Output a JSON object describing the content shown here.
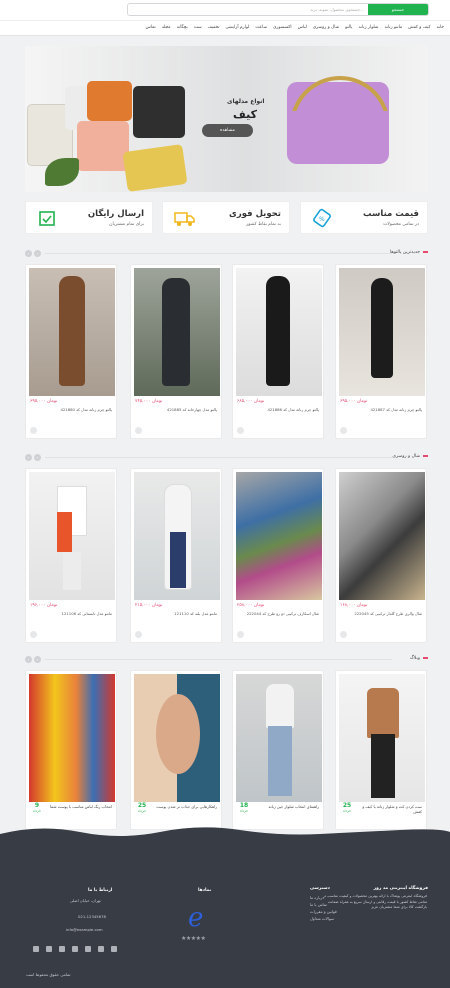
{
  "header": {
    "search_button": "جستجو",
    "search_placeholder": "جستجوی محصول، نمونه، برند..."
  },
  "nav": {
    "items": [
      "خانه",
      "کیف و کفش",
      "مانتو زنانه",
      "شلوار زنانه",
      "پالتو",
      "شال و روسری",
      "لباس",
      "اکسسوری",
      "ساعت",
      "لوازم آرایشی",
      "تخفیف",
      "ست",
      "بچگانه",
      "مجله",
      "تماس"
    ]
  },
  "banner": {
    "line1": "انواع مدلهای",
    "line2": "کیف",
    "button": "مشاهده"
  },
  "features": [
    {
      "title": "قیمت مناسب",
      "subtitle": "در تمامی محصولات"
    },
    {
      "title": "تحویل فوری",
      "subtitle": "به تمام نقاط کشور"
    },
    {
      "title": "ارسال رایگان",
      "subtitle": "برای تمام مشتریان"
    }
  ],
  "sections": {
    "s1": "جدیدترین پالتوها",
    "s2": "شال و روسری",
    "s3": "وبلاگ"
  },
  "products1": [
    {
      "price": "۶۹۵,۰۰۰ تومان",
      "name": "پالتو چرم زنانه مدل کد 421887"
    },
    {
      "price": "۶۸۵,۰۰۰ تومان",
      "name": "پالتو چرم زنانه مدل کد 421886"
    },
    {
      "price": "۷۴۵,۰۰۰ تومان",
      "name": "پالتو مدل چهارخانه کد 421885"
    },
    {
      "price": "۶۹۵,۰۰۰ تومان",
      "name": "پالتو چرم زنانه مدل کد 421880"
    }
  ],
  "products2": [
    {
      "price": "۱۶۸,۰۰۰ تومان",
      "name": "شال والری طرح گلدار ترکیبی کد 222045"
    },
    {
      "price": "۲۵۸,۰۰۰ تومان",
      "name": "شال اسکارف ترکیبی دو رو طرح کد 222044"
    },
    {
      "price": "۲۱۵,۰۰۰ تومان",
      "name": "مانتو مدل بلند کد 121110"
    },
    {
      "price": "۱۹۶,۰۰۰ تومان",
      "name": "مانتو مدل تابستانی کد 121106"
    }
  ],
  "blog": [
    {
      "day": "25",
      "month": "خرداد",
      "title": "ست کردن کت و شلوار زنانه با کیف و کفش"
    },
    {
      "day": "18",
      "month": "خرداد",
      "title": "راهنمای انتخاب شلوار جین زنانه"
    },
    {
      "day": "25",
      "month": "خرداد",
      "title": "راهکارهایی برای جذاب تر شدن پوست"
    },
    {
      "day": "9",
      "month": "خرداد",
      "title": "انتخاب رنگ لباس مناسب با پوست شما"
    }
  ],
  "footer": {
    "about_title": "فروشگاه اینترنتی مد روز",
    "about_text": "فروشگاه اینترنتی پوشاک با ارائه بهترین محصولات و کیفیت مناسب در تمامی نقاط کشور با قیمت رقابتی و ارسال سریع به همراه ضمانت بازگشت کالا برای شما مشتریان عزیز",
    "links_title": "دسترسی",
    "links": [
      "درباره ما",
      "تماس با ما",
      "قوانین و مقررات",
      "سوالات متداول"
    ],
    "trust_title": "نمادها",
    "contact_title": "ارتباط با ما",
    "contact": [
      "تهران، خیابان اصلی",
      "021-12345678",
      "info@example.com"
    ],
    "copyright": "تمامی حقوق محفوظ است"
  },
  "colors": {
    "accent": "#e64a6f",
    "green": "#21b350",
    "footer_bg": "#383c45"
  }
}
